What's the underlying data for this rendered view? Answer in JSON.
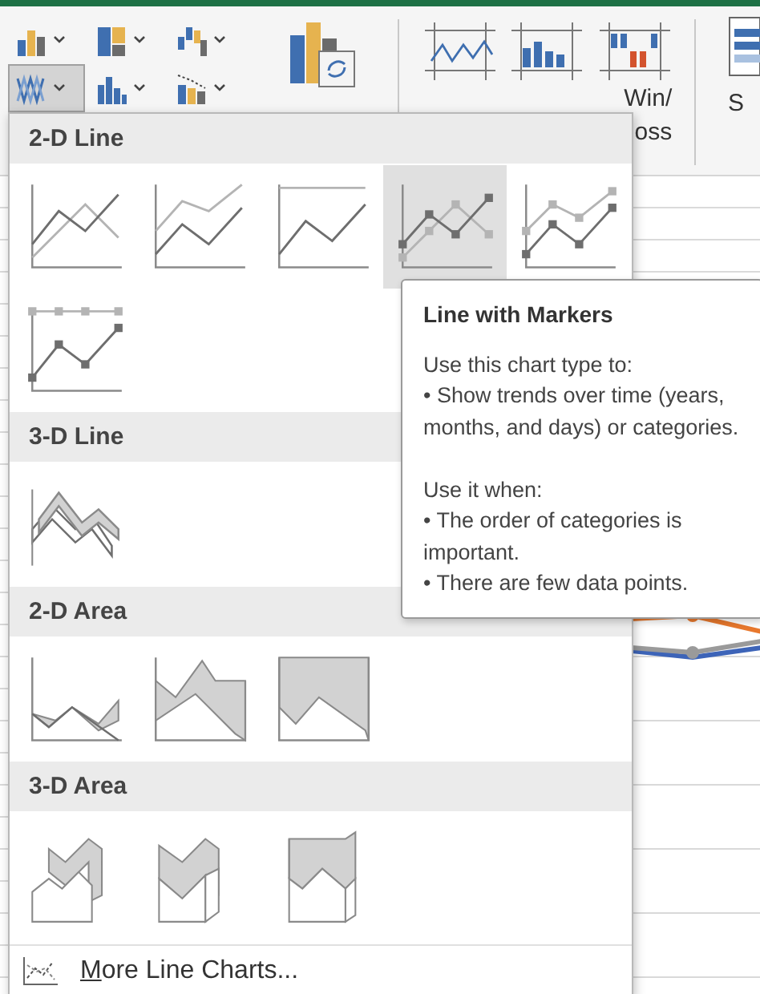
{
  "ribbon": {
    "chart_buttons": [
      {
        "kind": "column",
        "selected": false
      },
      {
        "kind": "hierarchy",
        "selected": false
      },
      {
        "kind": "waterfall",
        "selected": false
      },
      {
        "kind": "line",
        "selected": true
      },
      {
        "kind": "statistic",
        "selected": false
      },
      {
        "kind": "combo",
        "selected": false
      }
    ],
    "sparklines": [
      {
        "kind": "line"
      },
      {
        "kind": "column"
      },
      {
        "kind": "winloss",
        "label": "Win/",
        "label_2": "oss"
      }
    ],
    "slicer": {
      "label": "S"
    }
  },
  "menu": {
    "sections": [
      {
        "title": "2-D Line",
        "items": [
          {
            "kind": "line",
            "selected": false
          },
          {
            "kind": "stacked",
            "selected": false
          },
          {
            "kind": "percent",
            "selected": false
          },
          {
            "kind": "markers",
            "selected": true
          },
          {
            "kind": "stackedmarkers",
            "selected": false
          },
          {
            "kind": "percentmarkers",
            "selected": false
          }
        ]
      },
      {
        "title": "3-D Line",
        "items": [
          {
            "kind": "line3d",
            "selected": false
          }
        ]
      },
      {
        "title": "2-D Area",
        "items": [
          {
            "kind": "area",
            "selected": false
          },
          {
            "kind": "stackedarea",
            "selected": false
          },
          {
            "kind": "percentarea",
            "selected": false
          }
        ]
      },
      {
        "title": "3-D Area",
        "items": [
          {
            "kind": "area3d",
            "selected": false
          },
          {
            "kind": "stackedarea3d",
            "selected": false
          },
          {
            "kind": "percentarea3d",
            "selected": false
          }
        ]
      }
    ],
    "footer": "More Line Charts..."
  },
  "tooltip": {
    "title": "Line with Markers",
    "paragraphs": [
      [
        "Use this chart type to:",
        "• Show trends over time (years, months, and days) or categories."
      ],
      [
        "Use it when:",
        "• The order of categories is important.",
        "• There are few data points."
      ]
    ]
  }
}
